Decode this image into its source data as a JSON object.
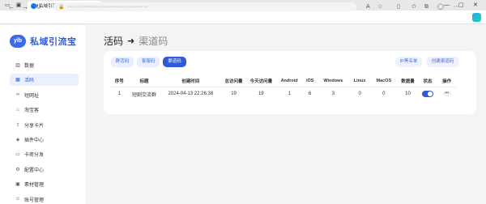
{
  "browser": {
    "tab_title": "私域引流宝 - 私域流量获取与转化",
    "url": "••••••••••••••••••••••••••••••••••"
  },
  "brand": {
    "badge": "ylb",
    "name": "私域引流宝",
    "accent": "#2f5cd6"
  },
  "sidebar": {
    "items": [
      {
        "label": "数据",
        "icon": "chart-icon"
      },
      {
        "label": "活码",
        "icon": "qrcode-icon",
        "active": true
      },
      {
        "label": "短网址",
        "icon": "link-icon"
      },
      {
        "label": "淘宝客",
        "icon": "shop-icon"
      },
      {
        "label": "分享卡片",
        "icon": "share-icon"
      },
      {
        "label": "插件中心",
        "icon": "plugin-icon"
      },
      {
        "label": "卡密分发",
        "icon": "card-icon"
      },
      {
        "label": "配置中心",
        "icon": "gear-icon"
      },
      {
        "label": "素材管理",
        "icon": "image-icon"
      },
      {
        "label": "账号管理",
        "icon": "user-icon"
      }
    ]
  },
  "page": {
    "title": "活码",
    "arrow": "➜",
    "subtitle": "渠道码"
  },
  "filters": {
    "tabs": [
      "群活码",
      "客服码",
      "渠道码"
    ],
    "active_tab": "渠道码",
    "ip_blacklist": "IP黑名单",
    "create": "创建渠道码"
  },
  "table": {
    "columns": [
      "序号",
      "标题",
      "创建时间",
      "总访问量",
      "今天访问量",
      "Android",
      "iOS",
      "Windows",
      "Linux",
      "MacOS",
      "数据量",
      "状态",
      "操作"
    ],
    "rows": [
      [
        "1",
        "短剧交流群",
        "2024-04-13 22:26:38",
        "19",
        "19",
        "1",
        "6",
        "3",
        "0",
        "0",
        "10"
      ]
    ],
    "status_on": true,
    "more_label": "•••"
  }
}
